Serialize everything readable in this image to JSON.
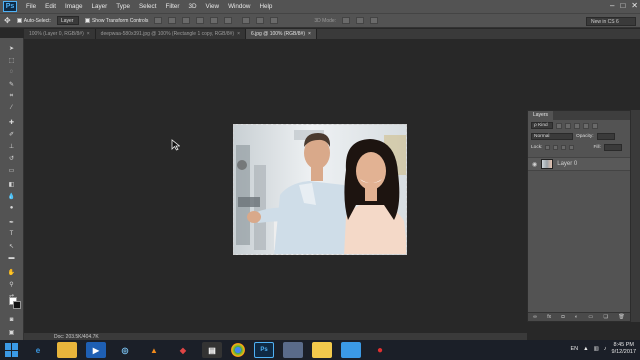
{
  "app": {
    "logo": "Ps",
    "window_controls": [
      "–",
      "□",
      "✕"
    ]
  },
  "menubar": {
    "items": [
      "File",
      "Edit",
      "Image",
      "Layer",
      "Type",
      "Select",
      "Filter",
      "3D",
      "View",
      "Window",
      "Help"
    ]
  },
  "options": {
    "auto_select_label": "Auto-Select:",
    "auto_select_value": "Layer",
    "transform_label": "Show Transform Controls",
    "mode_3d_label": "3D Mode:",
    "workspace": "New in CS 6"
  },
  "tabs": [
    {
      "label": "100% (Layer 0, RGB/8#)",
      "active": false
    },
    {
      "label": "deepwaa-580x391.jpg @ 100% (Rectangle 1 copy, RGB/8#)",
      "active": false
    },
    {
      "label": "6.jpg @ 100% (RGB/8#)",
      "active": true
    }
  ],
  "status": {
    "doc": "Doc: 203.5K/404.7K"
  },
  "layers": {
    "tab": "Layers",
    "kind": "Kind",
    "blend_mode": "Normal",
    "opacity_label": "Opacity:",
    "lock_label": "Lock:",
    "fill_label": "Fill:",
    "layer_name": "Layer 0"
  },
  "taskbar": {
    "lang": "EN",
    "time": "8:45 PM",
    "date": "9/12/2017"
  },
  "colors": {
    "accent": "#4fb1f5",
    "panel": "#535353",
    "workspace_bg": "#282828"
  }
}
